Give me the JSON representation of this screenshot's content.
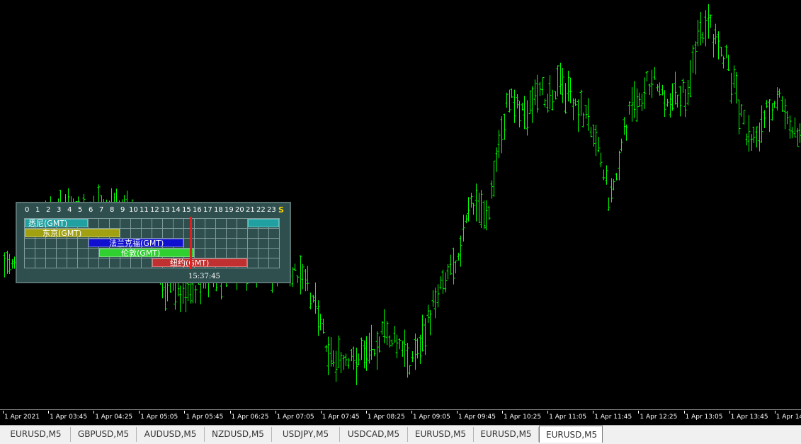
{
  "chart": {
    "symbol": "EURUSD",
    "timeframe": "M5",
    "bar_color": "#00ff00",
    "background": "#000000"
  },
  "time_axis": [
    "1 Apr 2021",
    "1 Apr 03:45",
    "1 Apr 04:25",
    "1 Apr 05:05",
    "1 Apr 05:45",
    "1 Apr 06:25",
    "1 Apr 07:05",
    "1 Apr 07:45",
    "1 Apr 08:25",
    "1 Apr 09:05",
    "1 Apr 09:45",
    "1 Apr 10:25",
    "1 Apr 11:05",
    "1 Apr 11:45",
    "1 Apr 12:25",
    "1 Apr 13:05",
    "1 Apr 13:45",
    "1 Apr 14:"
  ],
  "session_panel": {
    "hours": [
      "0",
      "1",
      "2",
      "3",
      "4",
      "5",
      "6",
      "7",
      "8",
      "9",
      "10",
      "11",
      "12",
      "13",
      "14",
      "15",
      "16",
      "17",
      "18",
      "19",
      "20",
      "21",
      "22",
      "23"
    ],
    "s_label": "S",
    "clock": "15:37:45",
    "now_hour": 15.6,
    "sessions": [
      {
        "name": "悉尼(GMT)",
        "start": 0,
        "end": 6,
        "color": "#20a0a0",
        "wrap_start": 21,
        "wrap_end": 24
      },
      {
        "name": "东京(GMT)",
        "start": 0,
        "end": 9,
        "color": "#a0a010"
      },
      {
        "name": "法兰克福(GMT)",
        "start": 6,
        "end": 15,
        "color": "#1010d0"
      },
      {
        "name": "伦敦(GMT)",
        "start": 7,
        "end": 16,
        "color": "#30d030"
      },
      {
        "name": "纽约(GMT)",
        "start": 12,
        "end": 21,
        "color": "#c03030"
      }
    ]
  },
  "tabs": [
    {
      "label": "EURUSD,M5",
      "active": false
    },
    {
      "label": "GBPUSD,M5",
      "active": false
    },
    {
      "label": "AUDUSD,M5",
      "active": false
    },
    {
      "label": "NZDUSD,M5",
      "active": false
    },
    {
      "label": "USDJPY,M5",
      "active": false
    },
    {
      "label": "USDCAD,M5",
      "active": false
    },
    {
      "label": "EURUSD,M5",
      "active": false
    },
    {
      "label": "EURUSD,M5",
      "active": false
    },
    {
      "label": "EURUSD,M5",
      "active": true
    }
  ]
}
